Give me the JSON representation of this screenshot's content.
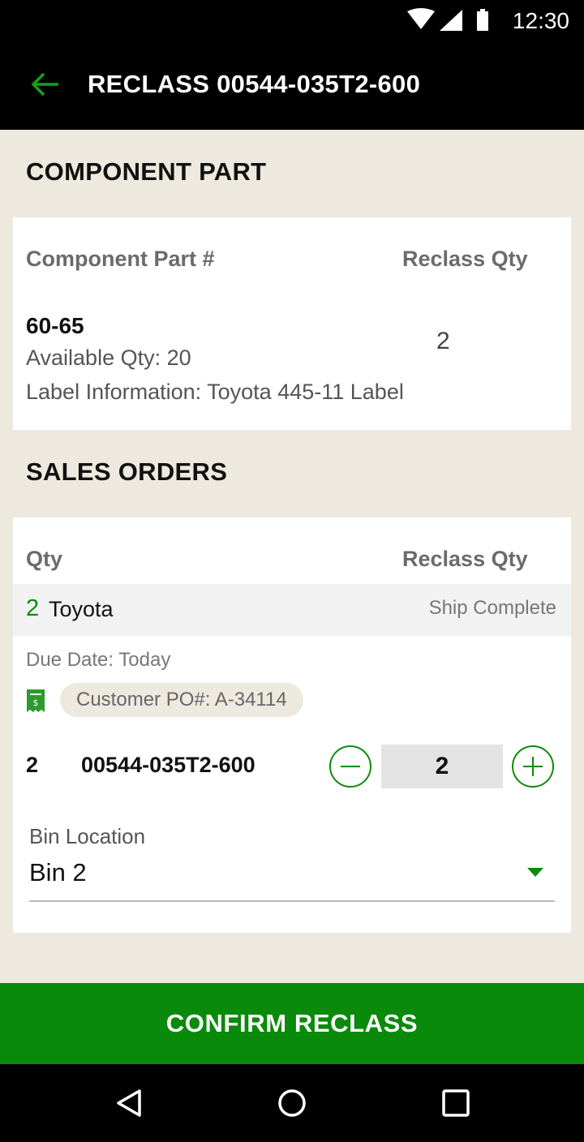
{
  "status_bar": {
    "time": "12:30",
    "icons": [
      "wifi-icon",
      "signal-icon",
      "battery-icon"
    ]
  },
  "app_bar": {
    "back_icon": "arrow-left-icon",
    "title": "RECLASS 00544-035T2-600"
  },
  "component_section": {
    "title": "COMPONENT PART",
    "headers": {
      "part": "Component Part #",
      "reclass_qty": "Reclass Qty"
    },
    "part_number": "60-65",
    "available_qty": "Available Qty: 20",
    "label_info": "Label Information: Toyota 445-11 Label",
    "reclass_qty": "2"
  },
  "sales_section": {
    "title": "SALES ORDERS",
    "headers": {
      "qty": "Qty",
      "reclass_qty": "Reclass Qty"
    },
    "order": {
      "qty": "2",
      "customer": "Toyota",
      "status": "Ship Complete",
      "due_date": "Due Date: Today",
      "po_icon": "receipt-icon",
      "po": "Customer PO#: A-34114"
    },
    "line": {
      "qty": "2",
      "part": "00544-035T2-600",
      "reclass_value": "2"
    },
    "bin": {
      "label": "Bin Location",
      "value": "Bin 2"
    }
  },
  "confirm_button": "CONFIRM RECLASS",
  "nav": [
    "back-triangle-icon",
    "home-circle-icon",
    "recents-square-icon"
  ],
  "colors": {
    "accent": "#0d8a0d",
    "background": "#ede9df",
    "bars": "#000000"
  }
}
